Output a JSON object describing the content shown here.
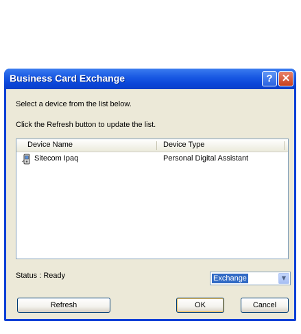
{
  "window": {
    "title": "Business Card Exchange",
    "help_glyph": "?",
    "close_glyph": "✕"
  },
  "instructions": {
    "line1": "Select a device from the list below.",
    "line2": "Click the Refresh button to update the list."
  },
  "device_list": {
    "columns": [
      "Device Name",
      "Device Type"
    ],
    "rows": [
      {
        "name": "Sitecom Ipaq",
        "type": "Personal Digital Assistant",
        "icon": "pda-device-icon"
      }
    ]
  },
  "status": {
    "text": "Status : Ready"
  },
  "mode_select": {
    "value": "Exchange"
  },
  "buttons": {
    "refresh": "Refresh",
    "ok": "OK",
    "cancel": "Cancel"
  },
  "colors": {
    "titlebar": "#0a45d8",
    "dialog_bg": "#ece9d8",
    "selection": "#316ac5"
  }
}
